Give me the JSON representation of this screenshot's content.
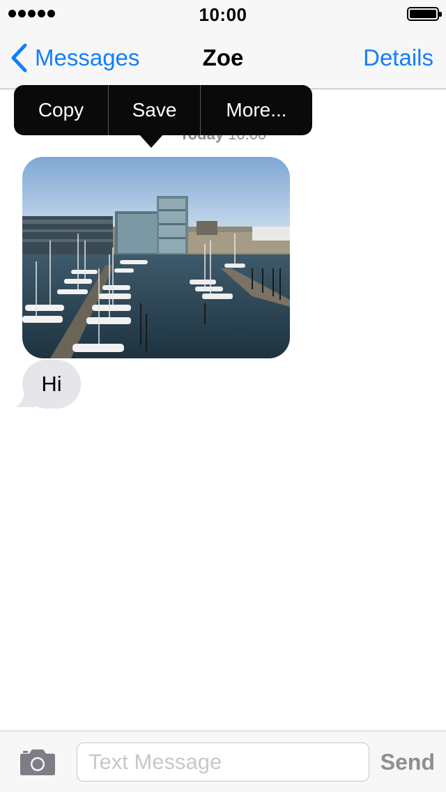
{
  "status_bar": {
    "time": "10:00",
    "signal_icon": "signal-dots-icon",
    "battery_icon": "battery-full-icon"
  },
  "nav": {
    "back_label": "Messages",
    "title": "Zoe",
    "details_label": "Details",
    "back_icon": "chevron-left-icon",
    "accent_color": "#147efb"
  },
  "context_menu": {
    "items": [
      {
        "label": "Copy"
      },
      {
        "label": "Save"
      },
      {
        "label": "More..."
      }
    ]
  },
  "conversation": {
    "timestamp_day": "Today",
    "timestamp_time": "10:00",
    "messages": [
      {
        "type": "image",
        "subject": "harbor-marina-photo"
      },
      {
        "type": "text",
        "text": "Hi",
        "bubble_color": "#e5e5ea"
      }
    ]
  },
  "input_bar": {
    "placeholder": "Text Message",
    "value": "",
    "send_label": "Send",
    "camera_icon": "camera-icon"
  }
}
